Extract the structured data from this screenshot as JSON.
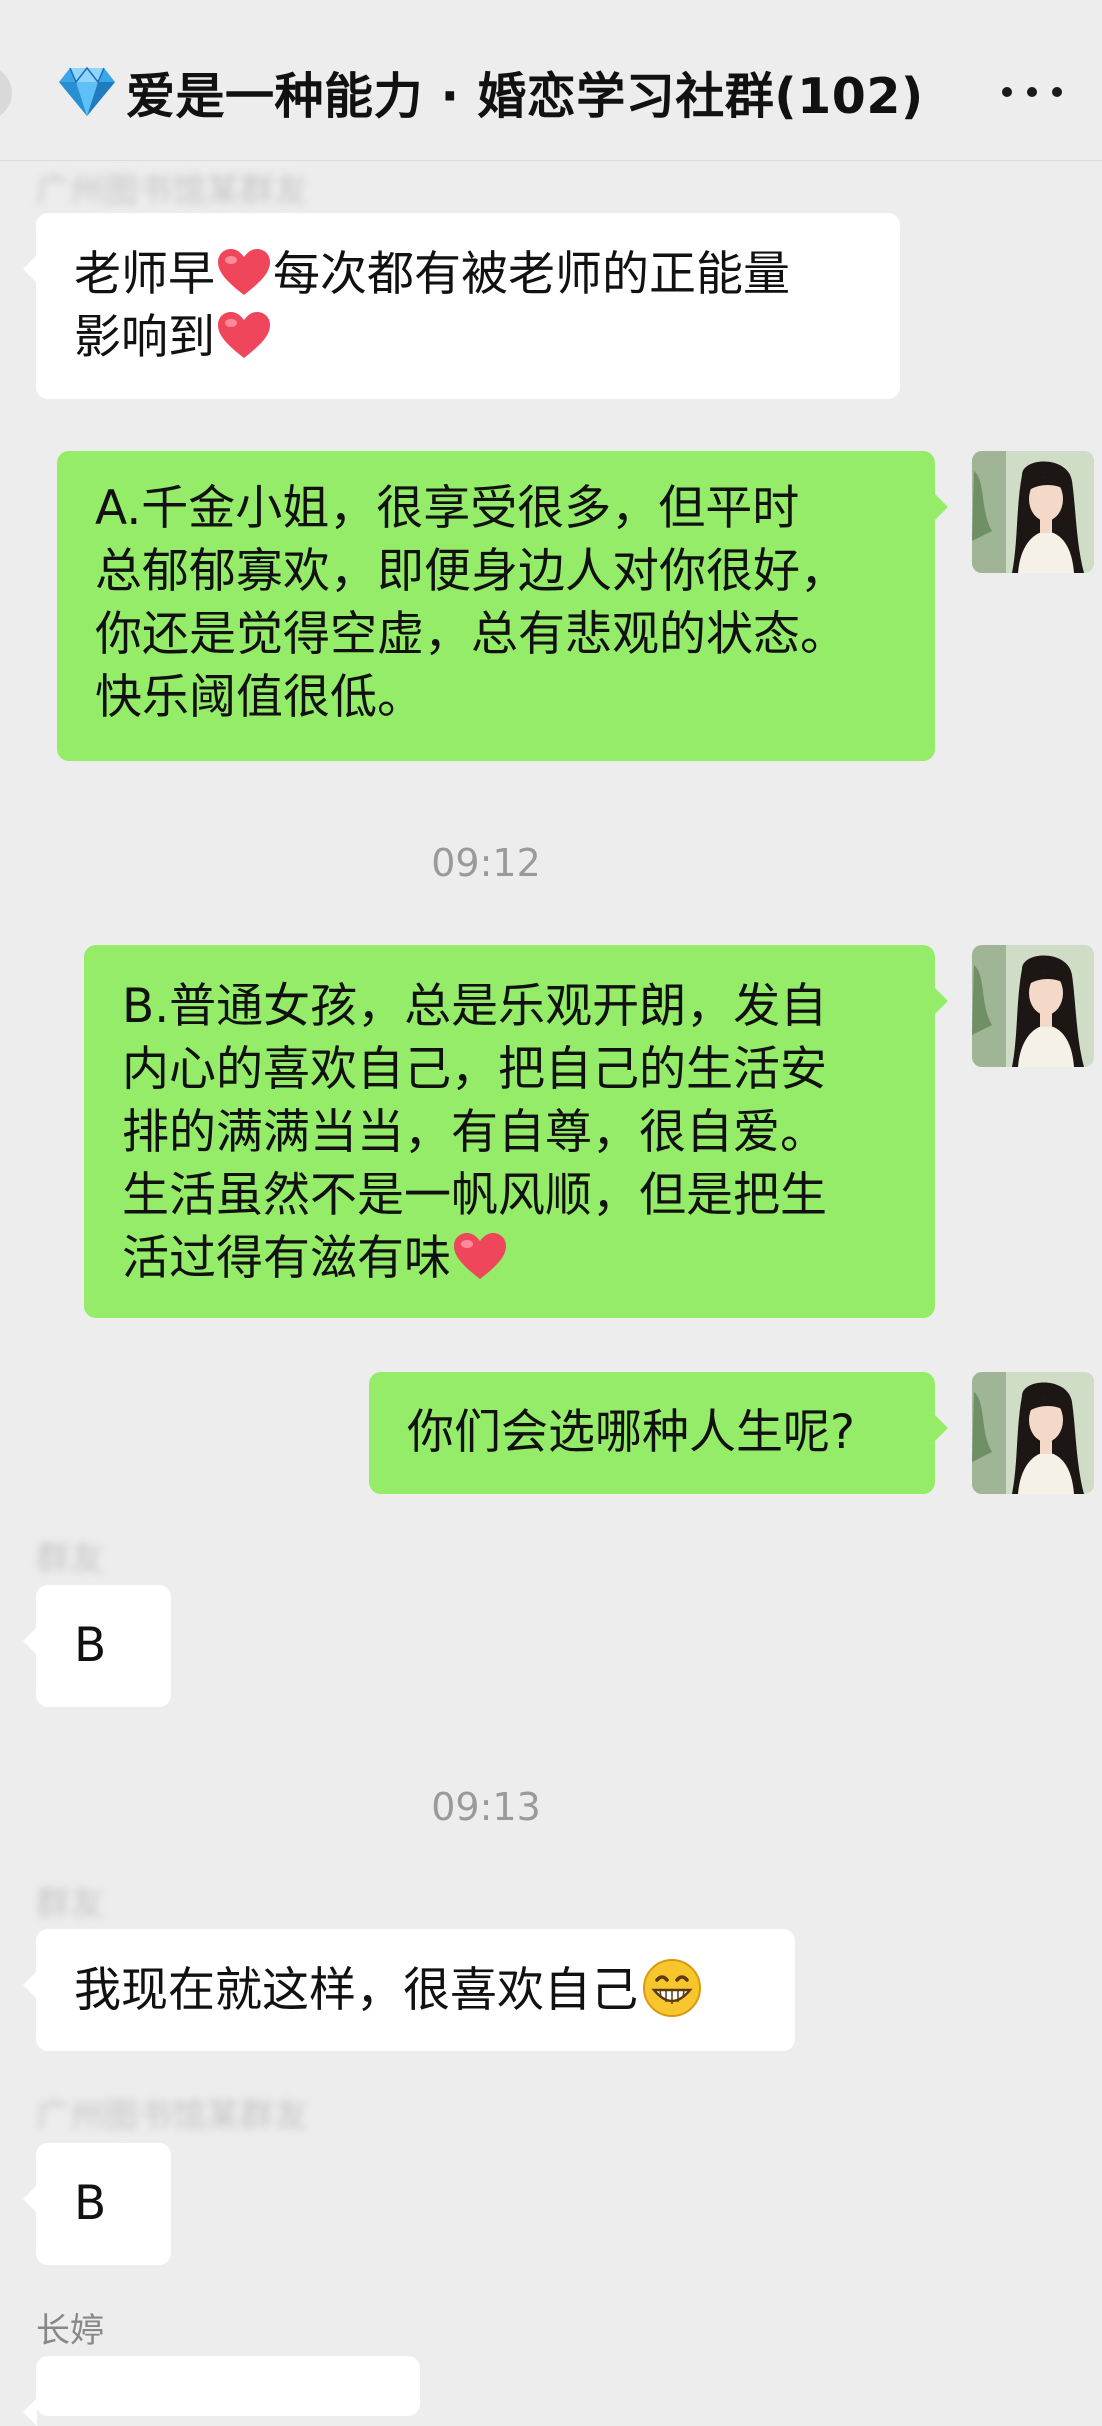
{
  "header": {
    "title": "爱是一种能力 · 婚恋学习社群(102)",
    "title_icon": "gem-icon",
    "more_icon": "more-dots-icon"
  },
  "messages": [
    {
      "sender": "广州图书馆某群友",
      "side": "left",
      "lines": [
        "老师早",
        "每次都有被老师的正能量",
        "影响到"
      ]
    },
    {
      "side": "right",
      "lines": [
        "A.千金小姐，很享受很多，但平时",
        "总郁郁寡欢，即便身边人对你很好，",
        "你还是觉得空虚，总有悲观的状态。",
        "快乐阈值很低。"
      ]
    },
    {
      "time": "09:12"
    },
    {
      "side": "right",
      "lines": [
        "B.普通女孩，总是乐观开朗，发自",
        "内心的喜欢自己，把自己的生活安",
        "排的满满当当，有自尊，很自爱。",
        "生活虽然不是一帆风顺，但是把生",
        "活过得有滋有味"
      ]
    },
    {
      "side": "right",
      "lines": [
        "你们会选哪种人生呢?"
      ]
    },
    {
      "sender": "群友",
      "side": "left",
      "lines": [
        "B"
      ]
    },
    {
      "time": "09:13"
    },
    {
      "sender": "群友",
      "side": "left",
      "lines": [
        "我现在就这样，很喜欢自己"
      ]
    },
    {
      "sender": "广州图书馆某群友",
      "side": "left",
      "lines": [
        "B"
      ]
    },
    {
      "sender": "长婷",
      "side": "left",
      "lines": []
    }
  ],
  "colors": {
    "background": "#ededed",
    "own_bubble": "#95ec69",
    "other_bubble": "#ffffff",
    "heart": "#f0465b"
  }
}
